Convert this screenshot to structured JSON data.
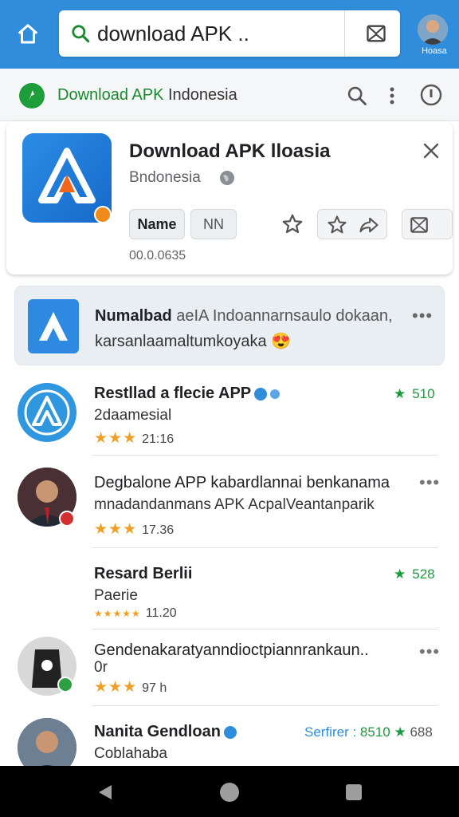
{
  "browser": {
    "search_text": "download APK ..",
    "avatar_label": "Hoasa"
  },
  "site": {
    "title_green": "Download APK",
    "title_rest": " Indonesia"
  },
  "app_card": {
    "title": "Download APK lloasia",
    "subtitle": "Bndonesia",
    "chip1": "Name",
    "chip2": "NN",
    "version": "00.0.0635"
  },
  "promo": {
    "line1_bold": "Numalbad",
    "line1_rest": " aeIA Indoannarnsaulo dokaan,",
    "line2": "karsanlaamaltumkoyaka 😍"
  },
  "list": [
    {
      "title": "Restllad a flecie APP",
      "subtitle": "2daamesial",
      "stars": "★★★",
      "rating_text": "21:16",
      "right_text": "510",
      "right_icon": "green-star"
    },
    {
      "title": "Degbalone APP kabardlannai benkanama",
      "subtitle": "mnadandanmans APK AcpalVeantanparik",
      "stars": "★★★",
      "rating_text": "17.36"
    },
    {
      "title": "Resard Berlii",
      "subtitle": "Paerie",
      "stars": "★★★★★",
      "rating_text": "11.20",
      "right_text": "528",
      "right_icon": "green-star"
    },
    {
      "title": "Gendenakaratyanndioctpiannrankaun..",
      "subtitle": "0r",
      "stars": "★★★",
      "rating_text": "97 h"
    },
    {
      "title": "Nanita Gendloan",
      "subtitle": "Coblahaba",
      "right_label": "Serfirer :",
      "right_text": "8510",
      "right_extra": "688"
    }
  ],
  "colors": {
    "accent": "#2f8ddb",
    "green": "#1c9a3e",
    "star": "#f0a020"
  }
}
